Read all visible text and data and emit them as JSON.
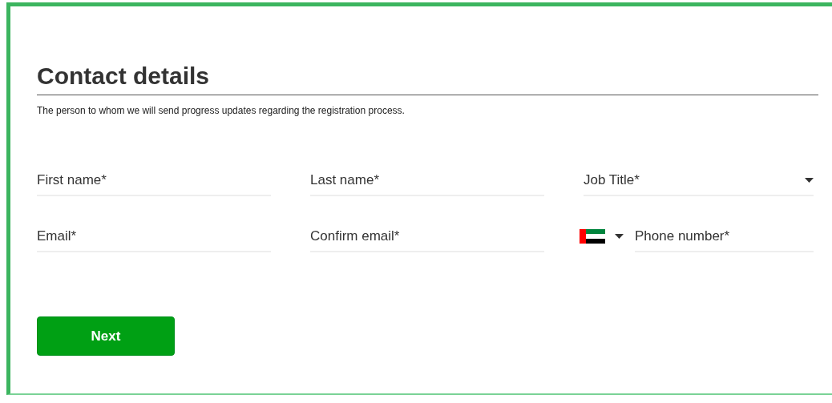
{
  "heading": "Contact details",
  "description": "The person to whom we will send progress updates regarding the registration process.",
  "fields": [
    {
      "kind": "text",
      "placeholder": "First name*"
    },
    {
      "kind": "text",
      "placeholder": "Last name*"
    },
    {
      "kind": "select",
      "placeholder": "Job Title*"
    },
    {
      "kind": "text",
      "placeholder": "Email*"
    },
    {
      "kind": "text",
      "placeholder": "Confirm email*"
    },
    {
      "kind": "phone",
      "placeholder": "Phone number*"
    }
  ],
  "button": "Next"
}
